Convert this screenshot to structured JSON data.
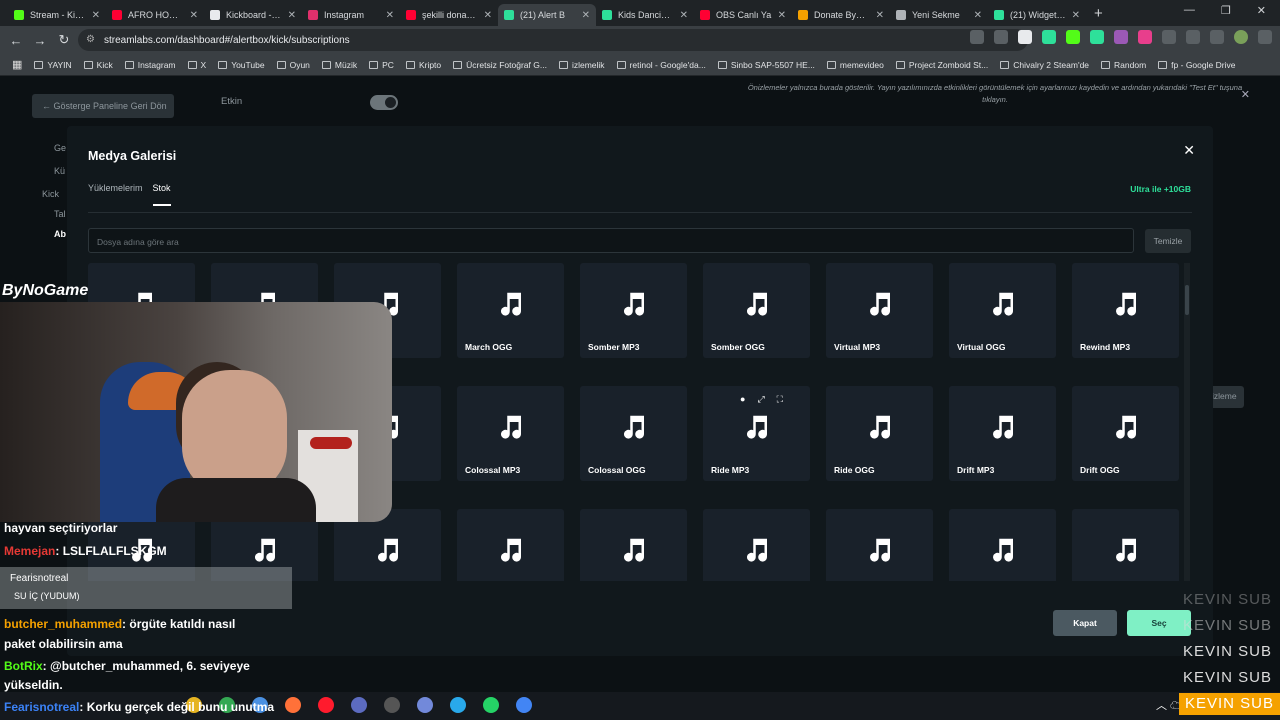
{
  "browser": {
    "tabs": [
      {
        "title": "Stream - Kick C",
        "color": "#53fc18"
      },
      {
        "title": "AFRO HOUSE",
        "color": "#ff0033"
      },
      {
        "title": "Kickboard - kic",
        "color": "#e8eaed"
      },
      {
        "title": "Instagram",
        "color": "#e1306c"
      },
      {
        "title": "şekilli donate l",
        "color": "#ff0033"
      },
      {
        "title": "(21) Alert B",
        "color": "#2ee09a"
      },
      {
        "title": "Kids Dancing G",
        "color": "#2ee09a"
      },
      {
        "title": "OBS Canlı Ya",
        "color": "#ff0033"
      },
      {
        "title": "Donate ByNoG",
        "color": "#f5a100"
      },
      {
        "title": "Yeni Sekme",
        "color": "#aeb3b7"
      },
      {
        "title": "(21) Widgets C",
        "color": "#2ee09a"
      }
    ],
    "new_tab": "+",
    "url": "streamlabs.com/dashboard#/alertbox/kick/subscriptions",
    "bookmarks": [
      "YAYIN",
      "Kick",
      "Instagram",
      "X",
      "YouTube",
      "Oyun",
      "Müzik",
      "PC",
      "Kripto",
      "Ücretsiz Fotoğraf G...",
      "izlemelik",
      "retinol - Google'da...",
      "Sinbo SAP-5507 HE...",
      "memevideo",
      "Project Zomboid St...",
      "Chivalry 2 Steam'de",
      "Random",
      "fp - Google Drive"
    ]
  },
  "dashboard": {
    "back_label": "Gösterge Paneline Geri Dön",
    "etkin_label": "Etkin",
    "notice": "Önizlemeler yalnızca burada gösterilir. Yayın yazılımınızda etkinlikleri görüntülemek için ayarlarınızı kaydedin ve ardından yukarıdaki \"Test Et\" tuşuna tıklayın.",
    "side_items": [
      "Ge",
      "Kü",
      "Kick",
      "Tal",
      "Ab"
    ],
    "right_btn": "izleme"
  },
  "modal": {
    "title": "Medya Galerisi",
    "tabs": [
      "Yüklemelerim",
      "Stok"
    ],
    "active_tab": "Stok",
    "ultra_label": "Ultra ile +10GB",
    "search_placeholder": "Dosya adına göre ara",
    "clear_label": "Temizle",
    "tiles_row1": [
      "",
      "",
      "",
      "March OGG",
      "Somber MP3",
      "Somber OGG",
      "Virtual MP3",
      "Virtual OGG",
      "Rewind MP3"
    ],
    "tiles_row2": [
      "",
      "",
      "",
      "Colossal MP3",
      "Colossal OGG",
      "Ride MP3",
      "Ride OGG",
      "Drift MP3",
      "Drift OGG"
    ],
    "tiles_row3": [
      "",
      "",
      "",
      "",
      "",
      "",
      "",
      "",
      ""
    ],
    "close_label": "Kapat",
    "select_label": "Seç"
  },
  "overlay": {
    "brand": "ByNoGame",
    "chat": [
      {
        "user": "",
        "text": "hayvan seçtiriyorlar"
      },
      {
        "user": "Memejan",
        "text": ": LSLFLALFLSKGM"
      },
      {
        "user": "butcher_muhammed",
        "text": ": örgüte katıldı nasıl"
      },
      {
        "user": "",
        "text": "paket olabilirsin ama"
      },
      {
        "user": "BotRix",
        "text": ": @butcher_muhammed, 6. seviyeye"
      },
      {
        "user": "",
        "text": "yükseldin."
      },
      {
        "user": "Fearisnotreal",
        "text": ": Korku gerçek değil bunu unutma"
      }
    ],
    "pinned_user": "Fearisnotreal",
    "pinned_text": "SU İÇ (YUDUM)",
    "subs": [
      "KEVIN SUB",
      "KEVIN SUB",
      "KEVIN SUB",
      "KEVIN SUB",
      "KEVIN SUB"
    ]
  }
}
